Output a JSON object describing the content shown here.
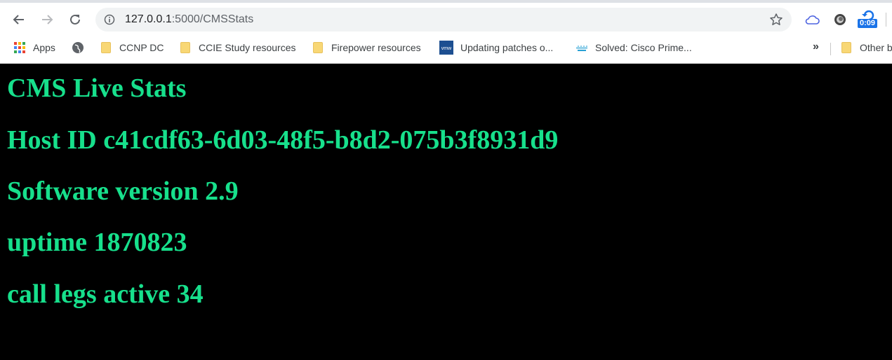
{
  "browser": {
    "url_host": "127.0.0.1",
    "url_path": ":5000/CMSStats",
    "extension_badge": "0:09"
  },
  "bookmarks": {
    "items": [
      {
        "label": "Apps",
        "icon": "apps-grid-icon"
      },
      {
        "label": "",
        "icon": "globe-icon"
      },
      {
        "label": "CCNP DC",
        "icon": "folder-icon"
      },
      {
        "label": "CCIE Study resources",
        "icon": "folder-icon"
      },
      {
        "label": "Firepower resources",
        "icon": "folder-icon"
      },
      {
        "label": "Updating patches o...",
        "icon": "vmware-icon"
      },
      {
        "label": "Solved: Cisco Prime...",
        "icon": "cisco-icon"
      }
    ],
    "overflow": "»",
    "other": "Other b"
  },
  "page": {
    "title": "CMS Live Stats",
    "host_id": "Host ID c41cdf63-6d03-48f5-b8d2-075b3f8931d9",
    "software_version": "Software version 2.9",
    "uptime": "uptime 1870823",
    "call_legs": "call legs active 34"
  },
  "colors": {
    "background": "#000000",
    "text": "#17e08c"
  }
}
